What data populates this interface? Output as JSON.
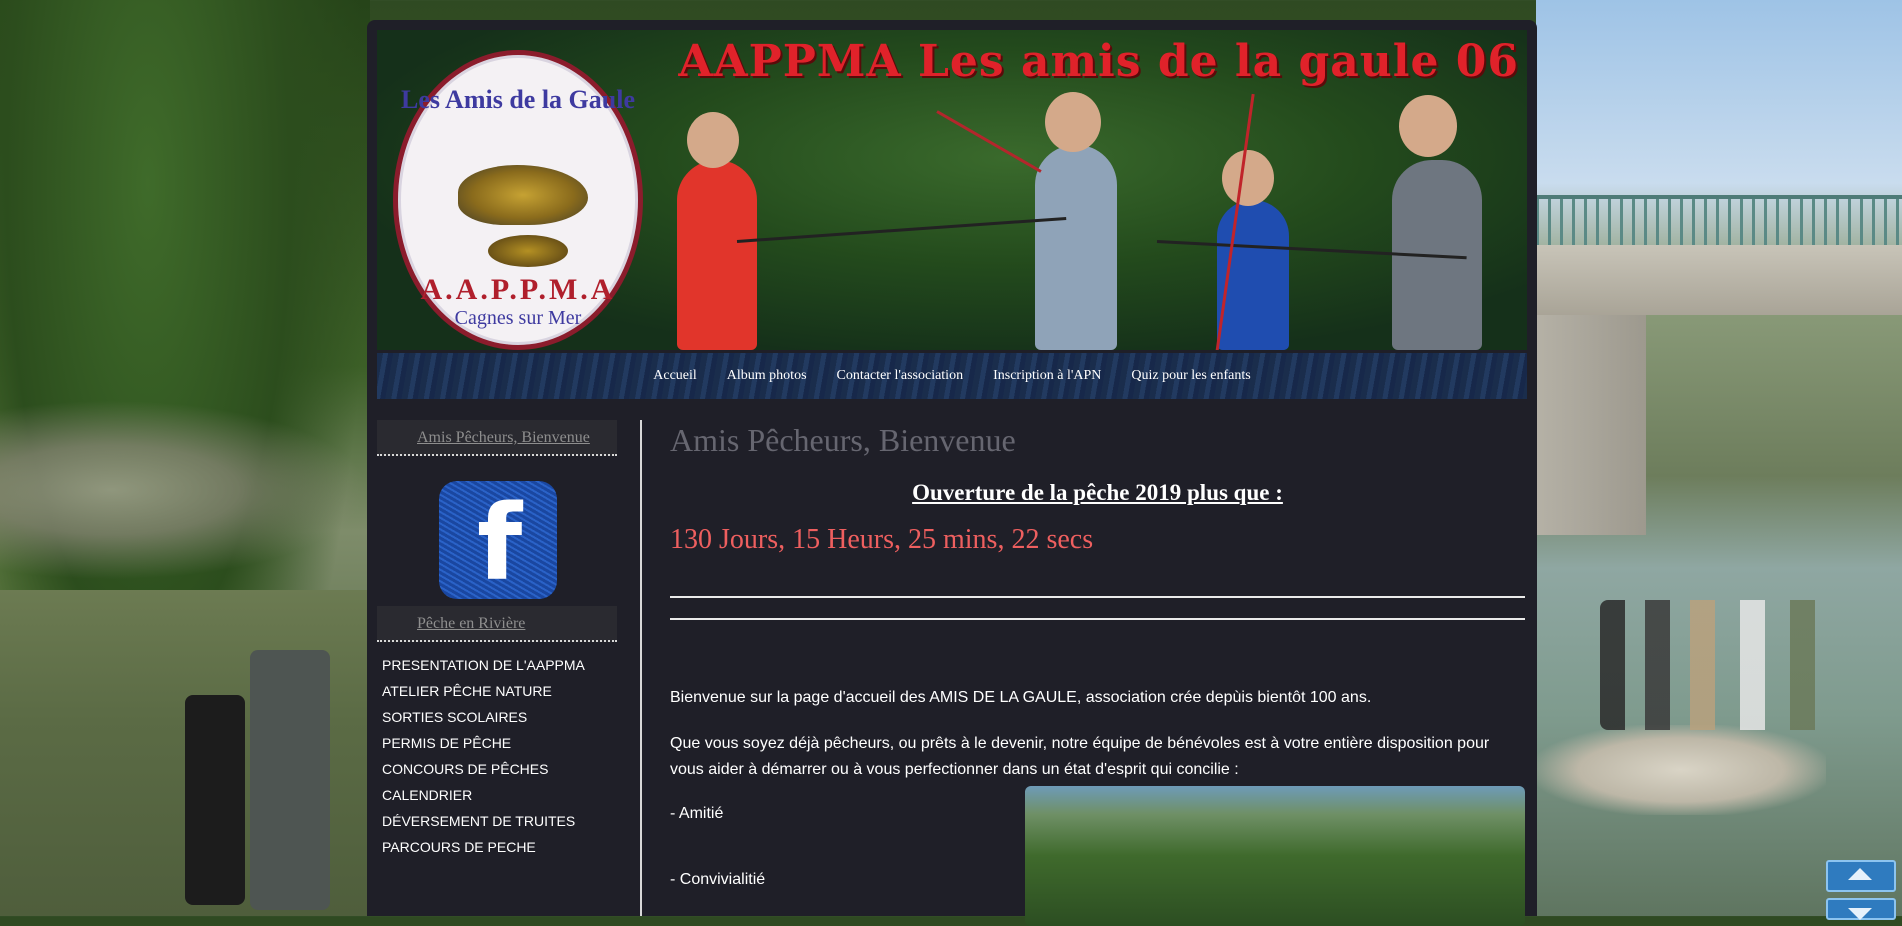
{
  "banner": {
    "title": "AAPPMA Les amis de la gaule 06",
    "logo_text_top": "Les Amis de la Gaule",
    "logo_text_mid": "A.A.P.P.M.A",
    "logo_text_bottom": "Cagnes sur Mer"
  },
  "nav": {
    "items": [
      {
        "label": "Accueil"
      },
      {
        "label": "Album photos"
      },
      {
        "label": "Contacter l'association"
      },
      {
        "label": "Inscription à l'APN"
      },
      {
        "label": "Quiz pour les enfants"
      }
    ]
  },
  "sidebar": {
    "section1_title": "Amis Pêcheurs, Bienvenue",
    "facebook_icon": "facebook-icon",
    "section2_title": "Pêche en Rivière",
    "items": [
      {
        "label": "PRESENTATION DE L'AAPPMA"
      },
      {
        "label": "ATELIER PÊCHE NATURE"
      },
      {
        "label": "SORTIES SCOLAIRES"
      },
      {
        "label": "PERMIS DE PÊCHE"
      },
      {
        "label": "CONCOURS DE PÊCHES"
      },
      {
        "label": "CALENDRIER"
      },
      {
        "label": "DÉVERSEMENT DE TRUITES"
      },
      {
        "label": "PARCOURS DE PECHE"
      }
    ]
  },
  "main": {
    "title": "Amis Pêcheurs, Bienvenue",
    "counter_title": "Ouverture de la pêche 2019 plus que :",
    "counter_value": "130 Jours, 15 Heurs, 25 mins, 22 secs",
    "para1": "Bienvenue sur la page d'accueil des AMIS DE LA GAULE, association crée depùis bientôt 100 ans.",
    "para2": "Que vous soyez déjà pêcheurs, ou prêts à le devenir, notre équipe de bénévoles est à votre entière disposition pour vous aider à démarrer ou à vous perfectionner dans un état d'esprit qui concilie :",
    "bullets": [
      {
        "label": "- Amitié"
      },
      {
        "label": "- Convivialitié"
      }
    ]
  },
  "colors": {
    "page_bg": "#1f1f28",
    "title_red": "#e0222a",
    "counter_red": "#ee5f5f",
    "scroll_blue": "#2f7bbf"
  },
  "scroll": {
    "up_icon": "arrow-up-icon",
    "down_icon": "arrow-down-icon"
  }
}
